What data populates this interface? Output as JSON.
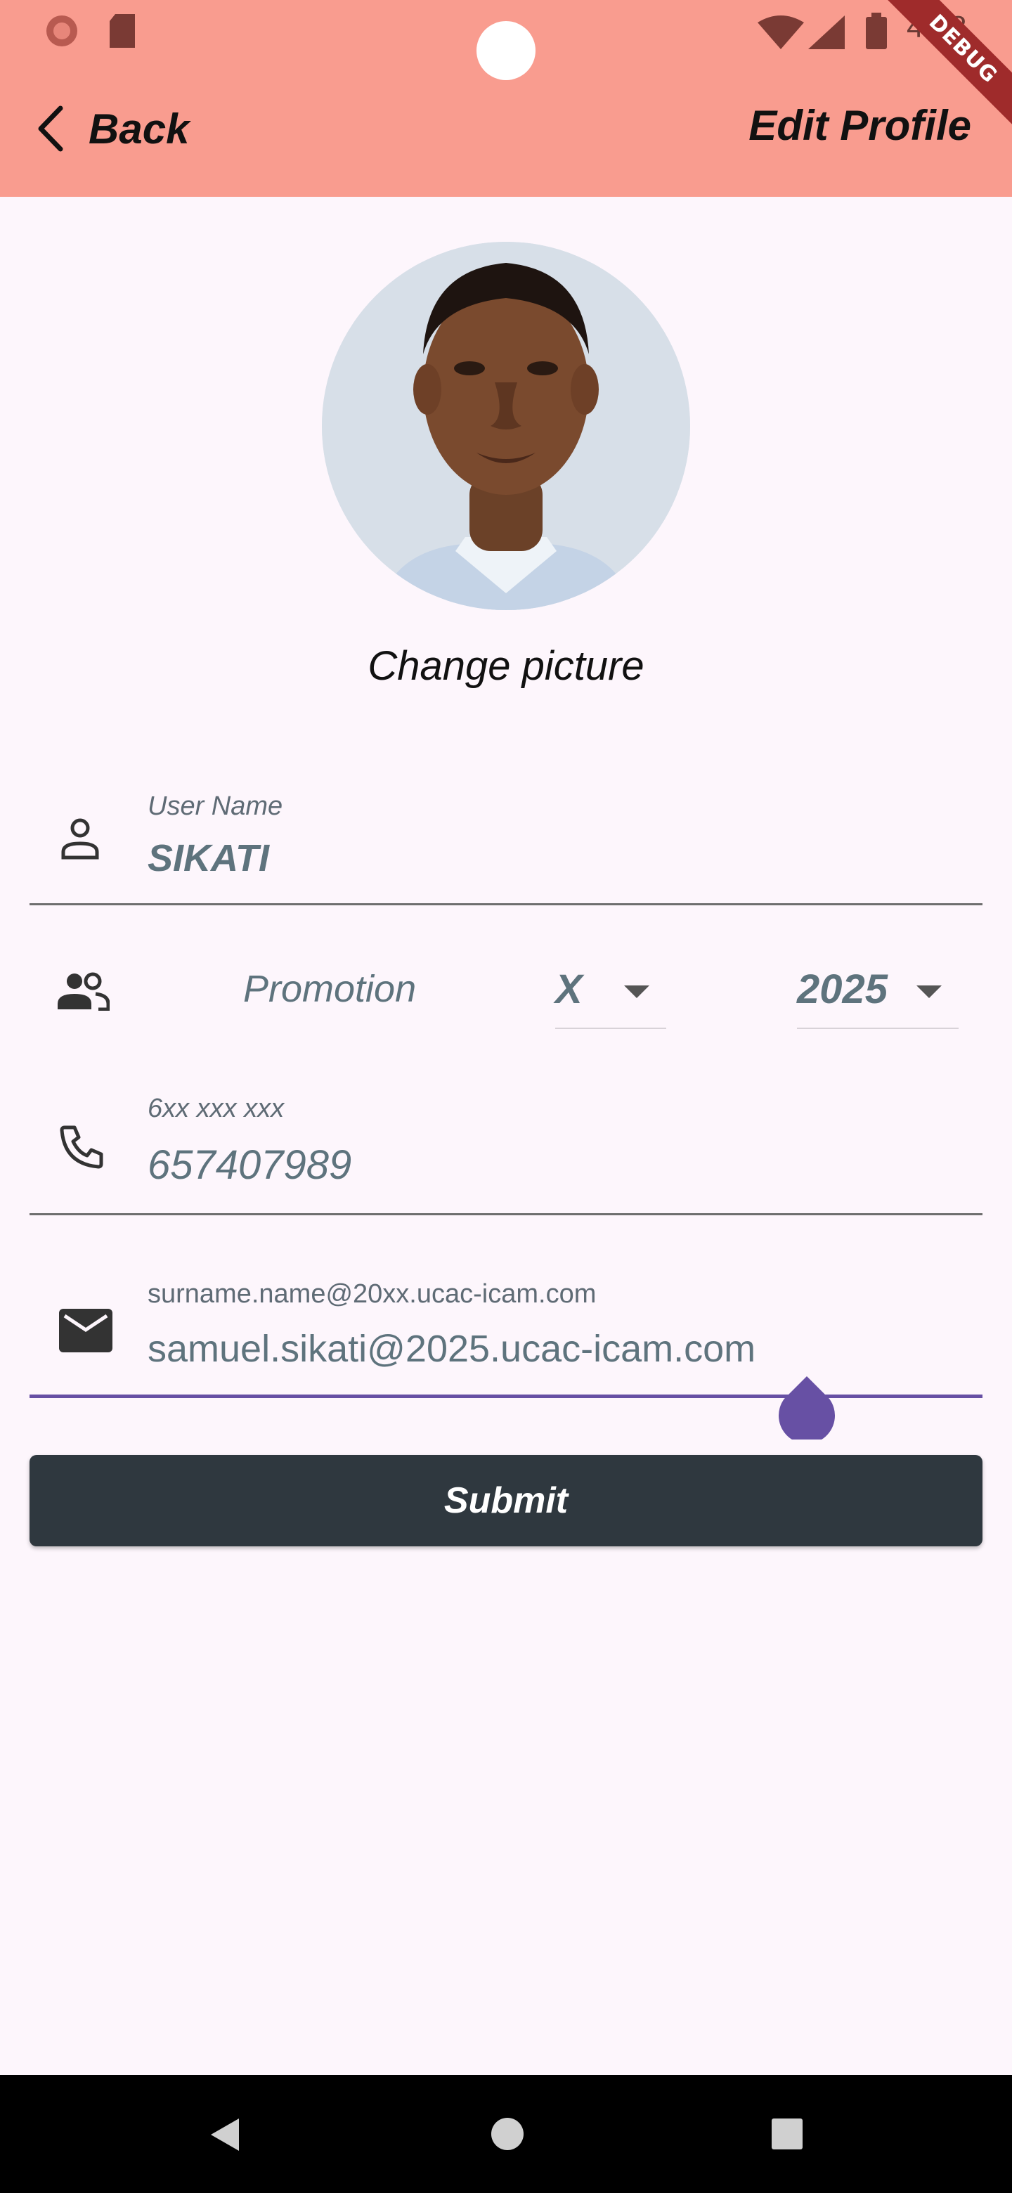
{
  "status_bar": {
    "time": "4:58"
  },
  "debug_banner": "DEBUG",
  "header": {
    "back_label": "Back",
    "title": "Edit Profile"
  },
  "profile": {
    "change_picture_label": "Change picture"
  },
  "form": {
    "username": {
      "label": "User Name",
      "value": "SIKATI"
    },
    "promotion": {
      "label": "Promotion",
      "letter": "X",
      "year": "2025"
    },
    "phone": {
      "label": "6xx xxx xxx",
      "value": "657407989"
    },
    "email": {
      "label": "surname.name@20xx.ucac-icam.com",
      "value": "samuel.sikati@2025.ucac-icam.com"
    },
    "submit_label": "Submit"
  },
  "colors": {
    "appbar": "#f99c8f",
    "background": "#fdf6fc",
    "submit": "#2f383f",
    "accent": "#6750a4"
  },
  "icons": [
    "person-icon",
    "people-icon",
    "phone-icon",
    "mail-icon",
    "back-chevron-icon"
  ]
}
